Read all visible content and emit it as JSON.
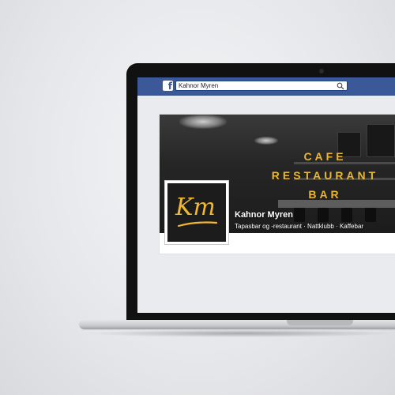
{
  "browser": {
    "search_value": "Kahnor Myren",
    "logo_glyph": "f"
  },
  "page": {
    "name": "Kahnor Myren",
    "categories": "Tapasbar og -restaurant · Nattklubb · Kaffebar"
  },
  "cover": {
    "line1": "CAFE",
    "line2": "RESTAURANT",
    "line3": "BAR"
  },
  "profile": {
    "logo_text": "Km"
  },
  "colors": {
    "facebook_blue": "#3b5998",
    "brand_gold": "#e9b632"
  }
}
